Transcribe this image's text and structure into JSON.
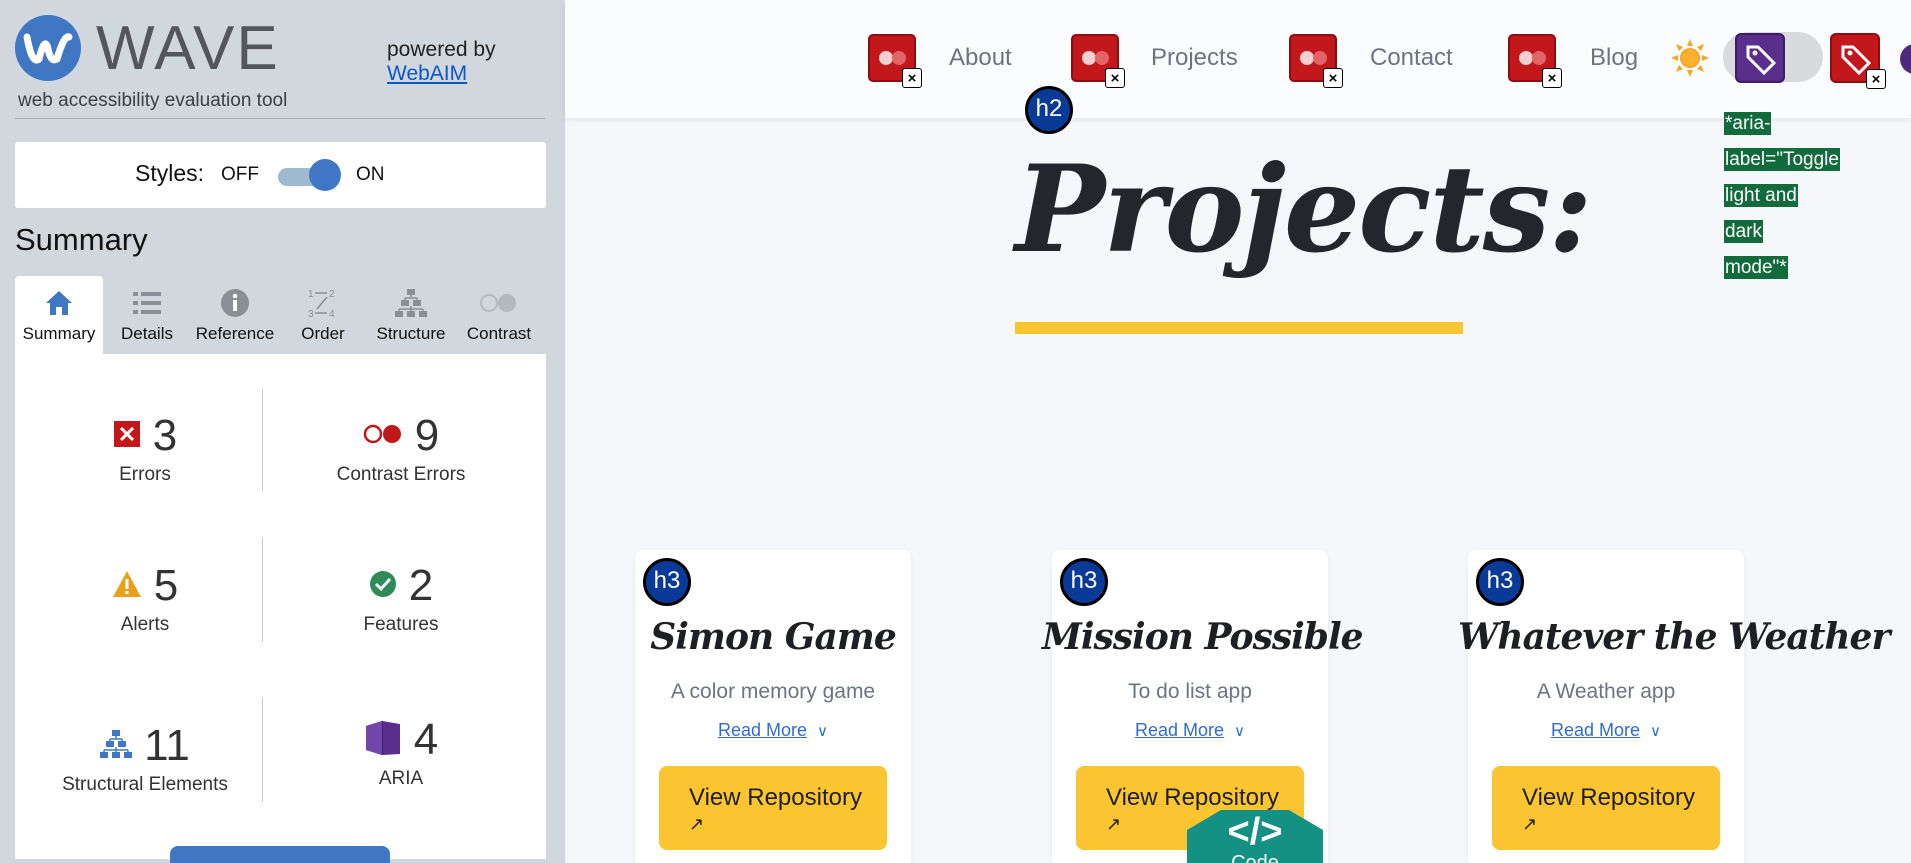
{
  "wave": {
    "logo_text": "WAVE",
    "tagline": "web accessibility evaluation tool",
    "powered_by": "powered by",
    "webaim_link": "WebAIM",
    "styles_label": "Styles:",
    "styles_off": "OFF",
    "styles_on": "ON",
    "styles_on_state": true,
    "summary_title": "Summary",
    "tabs": [
      {
        "label": "Summary",
        "icon": "home-icon",
        "active": true
      },
      {
        "label": "Details",
        "icon": "list-icon"
      },
      {
        "label": "Reference",
        "icon": "info-icon"
      },
      {
        "label": "Order",
        "icon": "order-icon"
      },
      {
        "label": "Structure",
        "icon": "structure-icon"
      },
      {
        "label": "Contrast",
        "icon": "contrast-icon"
      }
    ],
    "stats": {
      "errors": {
        "count": "3",
        "label": "Errors"
      },
      "contrast_errors": {
        "count": "9",
        "label": "Contrast Errors"
      },
      "alerts": {
        "count": "5",
        "label": "Alerts"
      },
      "features": {
        "count": "2",
        "label": "Features"
      },
      "structural": {
        "count": "11",
        "label": "Structural Elements"
      },
      "aria": {
        "count": "4",
        "label": "ARIA"
      }
    },
    "colors": {
      "brand": "#3f77c4",
      "error": "#c2171b",
      "alert": "#e8a21a",
      "feature": "#2e8b57",
      "aria": "#5a2e8c"
    }
  },
  "page": {
    "nav": {
      "about": "About",
      "projects": "Projects",
      "contact": "Contact",
      "blog": "Blog"
    },
    "aria_note": [
      "*aria-",
      "label=\"Toggle",
      "light and",
      "dark",
      "mode\"*"
    ],
    "h2_badge": "h2",
    "h3_badge": "h3",
    "title": "Projects:",
    "cards": [
      {
        "title": "Simon Game",
        "subtitle": "A color memory game",
        "read_more": "Read More",
        "button": "View Repository"
      },
      {
        "title": "Mission Possible",
        "subtitle": "To do list app",
        "read_more": "Read More",
        "button": "View Repository"
      },
      {
        "title": "Whatever the Weather",
        "subtitle": "A Weather app",
        "read_more": "Read More",
        "button": "View Repository"
      }
    ],
    "code_badge": {
      "symbol": "</>",
      "label": "Code"
    },
    "colors": {
      "accent": "#fbc531",
      "link": "#2f6bd1",
      "text": "#25262b"
    }
  }
}
